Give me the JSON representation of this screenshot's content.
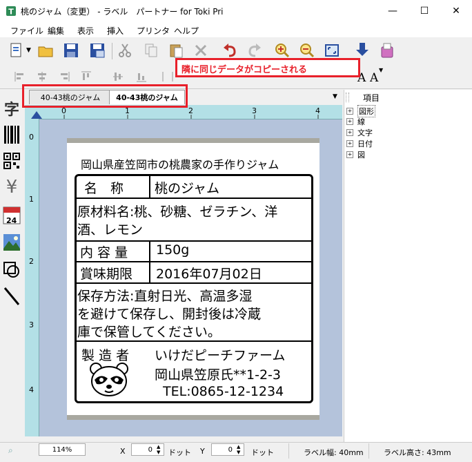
{
  "window": {
    "title": "桃のジャム（変更） - ラベル　パートナー for Toki Pri",
    "minimize": "—",
    "maximize": "☐",
    "close": "✕"
  },
  "menu": [
    "ファイル",
    "編集",
    "表示",
    "挿入",
    "プリンタ",
    "ヘルプ"
  ],
  "callout": {
    "text": "隣に同じデータがコピーされる",
    "color": "#e8202a"
  },
  "font_buttons": [
    "A",
    "A"
  ],
  "tabs": [
    {
      "label": "40-43桃のジャム",
      "active": false
    },
    {
      "label": "40-43桃のジャム",
      "active": true
    }
  ],
  "palette": [
    "字",
    "¥",
    "24"
  ],
  "ruler": {
    "h": [
      "0",
      "1",
      "2",
      "3",
      "4"
    ],
    "v": [
      "0",
      "1",
      "2",
      "3",
      "4"
    ]
  },
  "label": {
    "heading": "岡山県産笠岡市の桃農家の手作りジャム",
    "name_key": "名　称",
    "name_value": "桃のジャム",
    "ingredients_line1": "原材料名:桃、砂糖、ゼラチン、洋",
    "ingredients_line2": "酒、レモン",
    "content_key": "内 容 量",
    "content_value": "150g",
    "expiry_key": "賞味期限",
    "expiry_value": "2016年07月02日",
    "storage_line1": "保存方法:直射日光、高温多湿",
    "storage_line2": "を避けて保存し、開封後は冷蔵",
    "storage_line3": "庫で保管してください。",
    "maker_key": "製 造 者",
    "maker_name": "いけだピーチファーム",
    "maker_address": "岡山県笠原氏**1-2-3",
    "maker_tel": "TEL:0865-12-1234"
  },
  "panel": {
    "header": "項目",
    "items": [
      "図形",
      "線",
      "文字",
      "日付",
      "図"
    ]
  },
  "status": {
    "zoom": "114%",
    "x_label": "X",
    "x_value": "0",
    "x_unit": "ドット",
    "y_label": "Y",
    "y_value": "0",
    "y_unit": "ドット",
    "width": "ラベル幅: 40mm",
    "height": "ラベル高さ: 43mm"
  }
}
